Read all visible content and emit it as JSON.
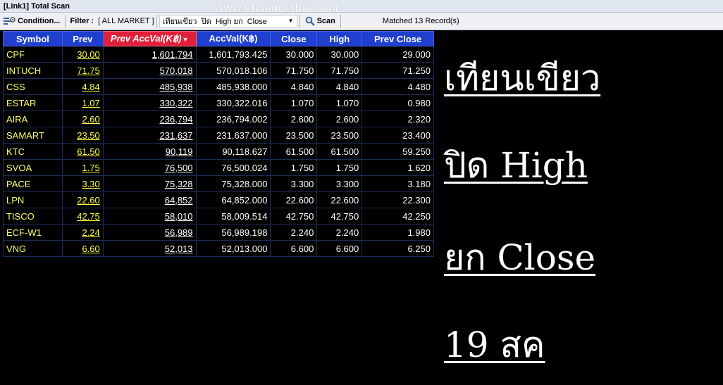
{
  "window": {
    "title": "[Link1] Total Scan"
  },
  "watermark": "www.efinancethai.com",
  "toolbar": {
    "condition_label": "Condition...",
    "filter_label": "Filter :",
    "filter_value": "[ ALL MARKET ]",
    "scan_combo_value": "เทียนเขียว  ปิด  High ยก  Close",
    "scan_label": "Scan",
    "matched_text": "Matched 13 Record(s)"
  },
  "grid": {
    "headers": [
      "Symbol",
      "Prev",
      "Prev AccVal(K฿)",
      "AccVal(K฿)",
      "Close",
      "High",
      "Prev Close"
    ],
    "rows": [
      {
        "symbol": "CPF",
        "prev": "30.00",
        "prev_accval": "1,601,794",
        "accval": "1,601,793.425",
        "close": "30.000",
        "high": "30.000",
        "prev_close": "29.000"
      },
      {
        "symbol": "INTUCH",
        "prev": "71.75",
        "prev_accval": "570,018",
        "accval": "570,018.106",
        "close": "71.750",
        "high": "71.750",
        "prev_close": "71.250"
      },
      {
        "symbol": "CSS",
        "prev": "4.84",
        "prev_accval": "485,938",
        "accval": "485,938.000",
        "close": "4.840",
        "high": "4.840",
        "prev_close": "4.480"
      },
      {
        "symbol": "ESTAR",
        "prev": "1.07",
        "prev_accval": "330,322",
        "accval": "330,322.016",
        "close": "1.070",
        "high": "1.070",
        "prev_close": "0.980"
      },
      {
        "symbol": "AIRA",
        "prev": "2.60",
        "prev_accval": "236,794",
        "accval": "236,794.002",
        "close": "2.600",
        "high": "2.600",
        "prev_close": "2.320"
      },
      {
        "symbol": "SAMART",
        "prev": "23.50",
        "prev_accval": "231,637",
        "accval": "231,637.000",
        "close": "23.500",
        "high": "23.500",
        "prev_close": "23.400"
      },
      {
        "symbol": "KTC",
        "prev": "61.50",
        "prev_accval": "90,119",
        "accval": "90,118.627",
        "close": "61.500",
        "high": "61.500",
        "prev_close": "59.250"
      },
      {
        "symbol": "SVOA",
        "prev": "1.75",
        "prev_accval": "76,500",
        "accval": "76,500.024",
        "close": "1.750",
        "high": "1.750",
        "prev_close": "1.620"
      },
      {
        "symbol": "PACE",
        "prev": "3.30",
        "prev_accval": "75,328",
        "accval": "75,328.000",
        "close": "3.300",
        "high": "3.300",
        "prev_close": "3.180"
      },
      {
        "symbol": "LPN",
        "prev": "22.60",
        "prev_accval": "64,852",
        "accval": "64,852.000",
        "close": "22.600",
        "high": "22.600",
        "prev_close": "22.300"
      },
      {
        "symbol": "TISCO",
        "prev": "42.75",
        "prev_accval": "58,010",
        "accval": "58,009.514",
        "close": "42.750",
        "high": "42.750",
        "prev_close": "42.250"
      },
      {
        "symbol": "ECF-W1",
        "prev": "2.24",
        "prev_accval": "56,989",
        "accval": "56,989.198",
        "close": "2.240",
        "high": "2.240",
        "prev_close": "1.980"
      },
      {
        "symbol": "VNG",
        "prev": "6.60",
        "prev_accval": "52,013",
        "accval": "52,013.000",
        "close": "6.600",
        "high": "6.600",
        "prev_close": "6.250"
      }
    ]
  },
  "caption": {
    "line1": "เทียนเขียว",
    "line2": "ปิด High",
    "line3": "ยก Close",
    "line4": "19 สค"
  },
  "colors": {
    "header_bg": "#1f3fcf",
    "sorted_header_bg": "#e0203a",
    "cell_text": "#ffff00",
    "background": "#000000"
  },
  "icons": {
    "condition": "filter-settings-icon",
    "scan": "magnifier-icon",
    "combo": "chevron-down-icon",
    "sort": "sort-desc-icon"
  }
}
